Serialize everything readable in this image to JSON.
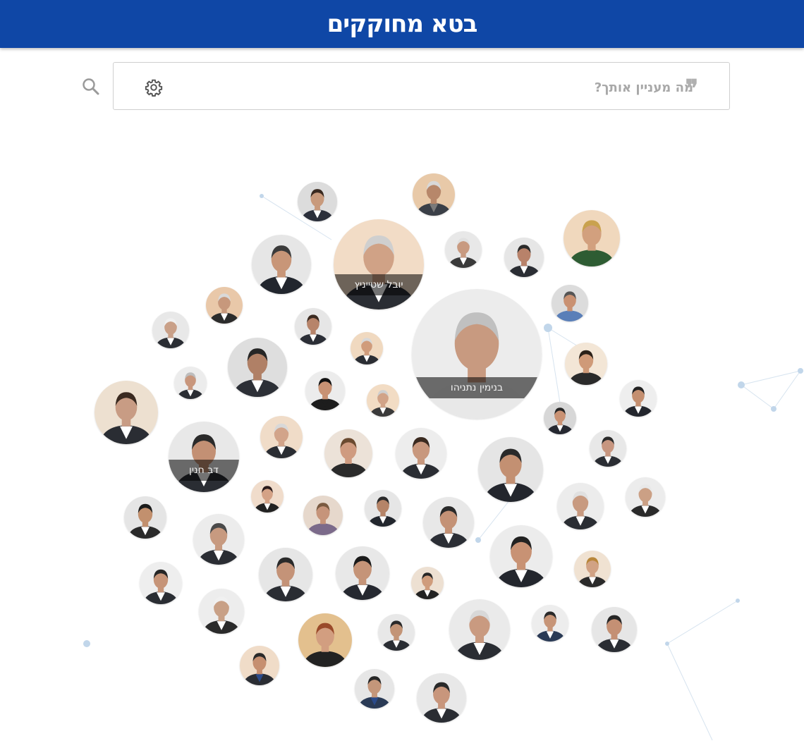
{
  "header": {
    "title": "בטא מחוקקים"
  },
  "search": {
    "placeholder": "מה מעניין אותך?",
    "value": ""
  },
  "icons": {
    "search": "search-icon",
    "settings": "gear-icon",
    "quote": "quote-icon"
  },
  "colors": {
    "header_bg": "#0f47a6",
    "network_line": "#c9dbea",
    "network_node": "#bcd3ea"
  },
  "featured_labels": {
    "top": "יובל שטייניץ",
    "center": "בנימין נתניהו",
    "left": "דב חנין"
  },
  "members": [
    {
      "label": "",
      "skin": "#c89a7c",
      "hair": "#3a2a20",
      "bg": "#dcdcdc",
      "suit": "#2b2f3a",
      "shirt": "#ffffff"
    },
    {
      "label": "",
      "skin": "#b7876a",
      "hair": "#d8d8d8",
      "bg": "#e8c9a8",
      "suit": "#3a3f47",
      "shirt": "#7a7a7a"
    },
    {
      "label": "",
      "skin": "#d2a07e",
      "hair": "#c9a24e",
      "bg": "#f0d8bd",
      "suit": "#2e5c33",
      "shirt": "#2e5c33"
    },
    {
      "label": "",
      "skin": "#c89678",
      "hair": "#3b3b3b",
      "bg": "#e6e6e6",
      "suit": "#22262e",
      "shirt": "#ffffff"
    },
    {
      "label": "",
      "skin": "#c89a80",
      "hair": "#e0e0e0",
      "bg": "#e8e8e8",
      "suit": "#3a3a3a",
      "shirt": "#ffffff"
    },
    {
      "label": "",
      "skin": "#b8826a",
      "hair": "#2a2a2a",
      "bg": "#e6e6e6",
      "suit": "#2a2d33",
      "shirt": "#ffffff"
    },
    {
      "label": "",
      "skin": "#c99172",
      "hair": "#555555",
      "bg": "#dcdcdc",
      "suit": "#5a7fb8",
      "shirt": "#5a7fb8"
    },
    {
      "label": "",
      "skin": "#c7987c",
      "hair": "#d9d9d9",
      "bg": "#e9c8a9",
      "suit": "#2b2b2b",
      "shirt": "#ffffff"
    },
    {
      "label": "",
      "skin": "#b7846a",
      "hair": "#3b2a20",
      "bg": "#e6e6e6",
      "suit": "#2b2e36",
      "shirt": "#ffffff"
    },
    {
      "label": "",
      "skin": "#c9a088",
      "hair": "#f0f0f0",
      "bg": "#e8e8e8",
      "suit": "#2a2d33",
      "shirt": "#ffffff"
    },
    {
      "label": "",
      "skin": "#d09c7c",
      "hair": "#d8d8d8",
      "bg": "#f0d9c0",
      "suit": "#2a2d33",
      "shirt": "#ffffff"
    },
    {
      "label": "",
      "skin": "#b08066",
      "hair": "#262626",
      "bg": "#dedede",
      "suit": "#2c2f36",
      "shirt": "#ffffff"
    },
    {
      "label": "",
      "skin": "#c8967c",
      "hair": "#bdbdbd",
      "bg": "#ececec",
      "suit": "#2a2d33",
      "shirt": "#ffffff"
    },
    {
      "label": "",
      "skin": "#c89274",
      "hair": "#111111",
      "bg": "#ececec",
      "suit": "#1d1d1d",
      "shirt": "#1d1d1d"
    },
    {
      "label": "",
      "skin": "#cf9a78",
      "hair": "#2a2018",
      "bg": "#f3e6d6",
      "suit": "#2a2a2a",
      "shirt": "#2a2a2a"
    },
    {
      "label": "",
      "skin": "#c89c84",
      "hair": "#3a2a20",
      "bg": "#ede0d0",
      "suit": "#2a2d33",
      "shirt": "#ffffff"
    },
    {
      "label": "",
      "skin": "#d1a388",
      "hair": "#cfcfcf",
      "bg": "#f2dcc4",
      "suit": "#3a3a3a",
      "shirt": "#ffffff"
    },
    {
      "label": "",
      "skin": "#c48f70",
      "hair": "#222222",
      "bg": "#eeeeee",
      "suit": "#23262d",
      "shirt": "#ffffff"
    },
    {
      "label": "",
      "skin": "#c99274",
      "hair": "#262626",
      "bg": "#d7d7d7",
      "suit": "#252830",
      "shirt": "#ffffff"
    },
    {
      "label": "",
      "skin": "#d2a48a",
      "hair": "#d8d8d8",
      "bg": "#f0dcc8",
      "suit": "#2a2d33",
      "shirt": "#ffffff"
    },
    {
      "label": "",
      "skin": "#cf9b80",
      "hair": "#6a4a30",
      "bg": "#ece2d8",
      "suit": "#2a2a2a",
      "shirt": "#2a2a2a"
    },
    {
      "label": "",
      "skin": "#c8987e",
      "hair": "#3a2a20",
      "bg": "#ededed",
      "suit": "#2a2d33",
      "shirt": "#ffffff"
    },
    {
      "label": "",
      "skin": "#c79680",
      "hair": "#2a2a2a",
      "bg": "#e8e8e8",
      "suit": "#2a2d33",
      "shirt": "#ffffff"
    },
    {
      "label": "",
      "skin": "#c39072",
      "hair": "#2a2a2a",
      "bg": "#e5e5e5",
      "suit": "#23262d",
      "shirt": "#ffffff"
    },
    {
      "label": "",
      "skin": "#c2906e",
      "hair": "#1a1a1a",
      "bg": "#e5e5e5",
      "suit": "#2a2a2a",
      "shirt": "#ffffff"
    },
    {
      "label": "",
      "skin": "#d4a286",
      "hair": "#2a1a1a",
      "bg": "#f0dccb",
      "suit": "#222222",
      "shirt": "#ffffff"
    },
    {
      "label": "",
      "skin": "#c6947a",
      "hair": "#7a5a40",
      "bg": "#e6d8cc",
      "suit": "#7b6a8a",
      "shirt": "#7b6a8a"
    },
    {
      "label": "",
      "skin": "#b58468",
      "hair": "#2a2a2a",
      "bg": "#e6e6e6",
      "suit": "#22262d",
      "shirt": "#ffffff"
    },
    {
      "label": "",
      "skin": "#c49276",
      "hair": "#2a2a2a",
      "bg": "#e8e8e8",
      "suit": "#2b2e35",
      "shirt": "#ffffff"
    },
    {
      "label": "",
      "skin": "#c89a80",
      "hair": "#e0e0e0",
      "bg": "#ececec",
      "suit": "#2a2d33",
      "shirt": "#ffffff"
    },
    {
      "label": "",
      "skin": "#cba085",
      "hair": "#e8e8e8",
      "bg": "#ececec",
      "suit": "#2a2a2a",
      "shirt": "#ffffff"
    },
    {
      "label": "",
      "skin": "#c79a80",
      "hair": "#4a4a4a",
      "bg": "#ececec",
      "suit": "#2a2d33",
      "shirt": "#ffffff"
    },
    {
      "label": "",
      "skin": "#c49378",
      "hair": "#2a2a2a",
      "bg": "#e6e6e6",
      "suit": "#2a2d33",
      "shirt": "#ffffff"
    },
    {
      "label": "",
      "skin": "#c59478",
      "hair": "#1a1a1a",
      "bg": "#e8e8e8",
      "suit": "#252830",
      "shirt": "#ffffff"
    },
    {
      "label": "",
      "skin": "#cf9c7c",
      "hair": "#262626",
      "bg": "#ede0d2",
      "suit": "#222222",
      "shirt": "#ffffff"
    },
    {
      "label": "",
      "skin": "#c89274",
      "hair": "#222222",
      "bg": "#ececec",
      "suit": "#23262d",
      "shirt": "#ffffff"
    },
    {
      "label": "",
      "skin": "#d1a284",
      "hair": "#b8863a",
      "bg": "#f0e2d2",
      "suit": "#2a2a2a",
      "shirt": "#ffffff"
    },
    {
      "label": "",
      "skin": "#c69478",
      "hair": "#262626",
      "bg": "#eeeeee",
      "suit": "#2a2d33",
      "shirt": "#ffffff"
    },
    {
      "label": "",
      "skin": "#c8a086",
      "hair": "#f0f0f0",
      "bg": "#ededed",
      "suit": "#2a2a2a",
      "shirt": "#ffffff"
    },
    {
      "label": "",
      "skin": "#d29e80",
      "hair": "#9a4a2a",
      "bg": "#e3c08e",
      "suit": "#222222",
      "shirt": "#222222"
    },
    {
      "label": "",
      "skin": "#c39476",
      "hair": "#2a2a2a",
      "bg": "#e8e8e8",
      "suit": "#2a2d33",
      "shirt": "#ffffff"
    },
    {
      "label": "",
      "skin": "#c99a80",
      "hair": "#d8d8d8",
      "bg": "#eaeaea",
      "suit": "#2a2d33",
      "shirt": "#ffffff"
    },
    {
      "label": "",
      "skin": "#c79578",
      "hair": "#2a2a2a",
      "bg": "#ededed",
      "suit": "#2a3a55",
      "shirt": "#ffffff"
    },
    {
      "label": "",
      "skin": "#c49074",
      "hair": "#262626",
      "bg": "#e6e6e6",
      "suit": "#2a2d33",
      "shirt": "#ffffff"
    },
    {
      "label": "",
      "skin": "#c68f70",
      "hair": "#2a2a2a",
      "bg": "#f0dcc8",
      "suit": "#2a2d33",
      "shirt": "#2a4a8a"
    },
    {
      "label": "",
      "skin": "#c4967a",
      "hair": "#262626",
      "bg": "#e6e6e6",
      "suit": "#2a3a55",
      "shirt": "#2a4a8a"
    },
    {
      "label": "",
      "skin": "#c8967c",
      "hair": "#2a2a2a",
      "bg": "#e8e8e8",
      "suit": "#2a2d33",
      "shirt": "#ffffff"
    },
    {
      "label": "",
      "skin": "#d0a286",
      "hair": "#cfcfcf",
      "bg": "#f2dcc6",
      "suit": "#2a2d33",
      "shirt": "#ffffff"
    },
    {
      "label": "",
      "skin": "#c89a80",
      "hair": "#c0c0c0",
      "bg": "#ececec",
      "suit": "#e8e8e8",
      "shirt": "#e8e8e8"
    },
    {
      "label": "",
      "skin": "#c39074",
      "hair": "#2a2a2a",
      "bg": "#e8e8e8",
      "suit": "#2a2d33",
      "shirt": "#ffffff"
    },
    {
      "label": "",
      "skin": "#cfa088",
      "hair": "#d0d0d0",
      "bg": "#f0dcc6",
      "suit": "#2a2d33",
      "shirt": "#ffffff"
    },
    {
      "label": "",
      "skin": "#c8967a",
      "hair": "#3a2a20",
      "bg": "#e6e6e6",
      "suit": "#2a2a2a",
      "shirt": "#2a2a2a"
    },
    {
      "label": "",
      "skin": "#c69479",
      "hair": "#2a2a2a",
      "bg": "#e8e8e8",
      "suit": "#2a2d33",
      "shirt": "#ffffff"
    }
  ]
}
